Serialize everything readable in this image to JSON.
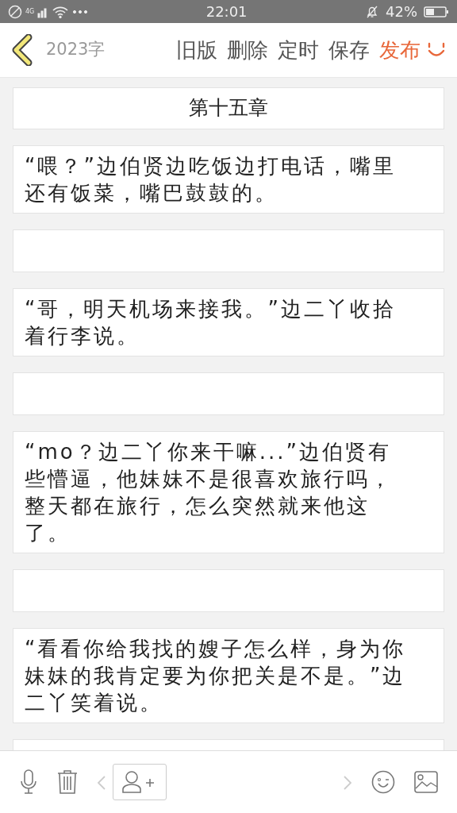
{
  "status_bar": {
    "network": "4G",
    "time": "22:01",
    "battery": "42%"
  },
  "header": {
    "word_count": "2023字",
    "actions": [
      {
        "label": "旧版",
        "kind": "normal"
      },
      {
        "label": "删除",
        "kind": "normal"
      },
      {
        "label": "定时",
        "kind": "normal"
      },
      {
        "label": "保存",
        "kind": "normal"
      },
      {
        "label": "发布",
        "kind": "publish"
      }
    ]
  },
  "blocks": [
    {
      "kind": "title",
      "text": "第十五章"
    },
    {
      "kind": "paragraph",
      "text": "“喂？”边伯贤边吃饭边打电话，嘴里还有饭菜，嘴巴鼓鼓的。"
    },
    {
      "kind": "empty"
    },
    {
      "kind": "paragraph",
      "text": "“哥，明天机场来接我。”边二丫收拾着行李说。"
    },
    {
      "kind": "empty"
    },
    {
      "kind": "paragraph",
      "text": "“mo？边二丫你来干嘛...”边伯贤有些懵逼，他妹妹不是很喜欢旅行吗，整天都在旅行，怎么突然就来他这了。"
    },
    {
      "kind": "empty"
    },
    {
      "kind": "paragraph",
      "text": "“看看你给我找的嫂子怎么样，身为你妹妹的我肯定要为你把关是不是。”边二丫笑着说。"
    },
    {
      "kind": "empty"
    }
  ]
}
